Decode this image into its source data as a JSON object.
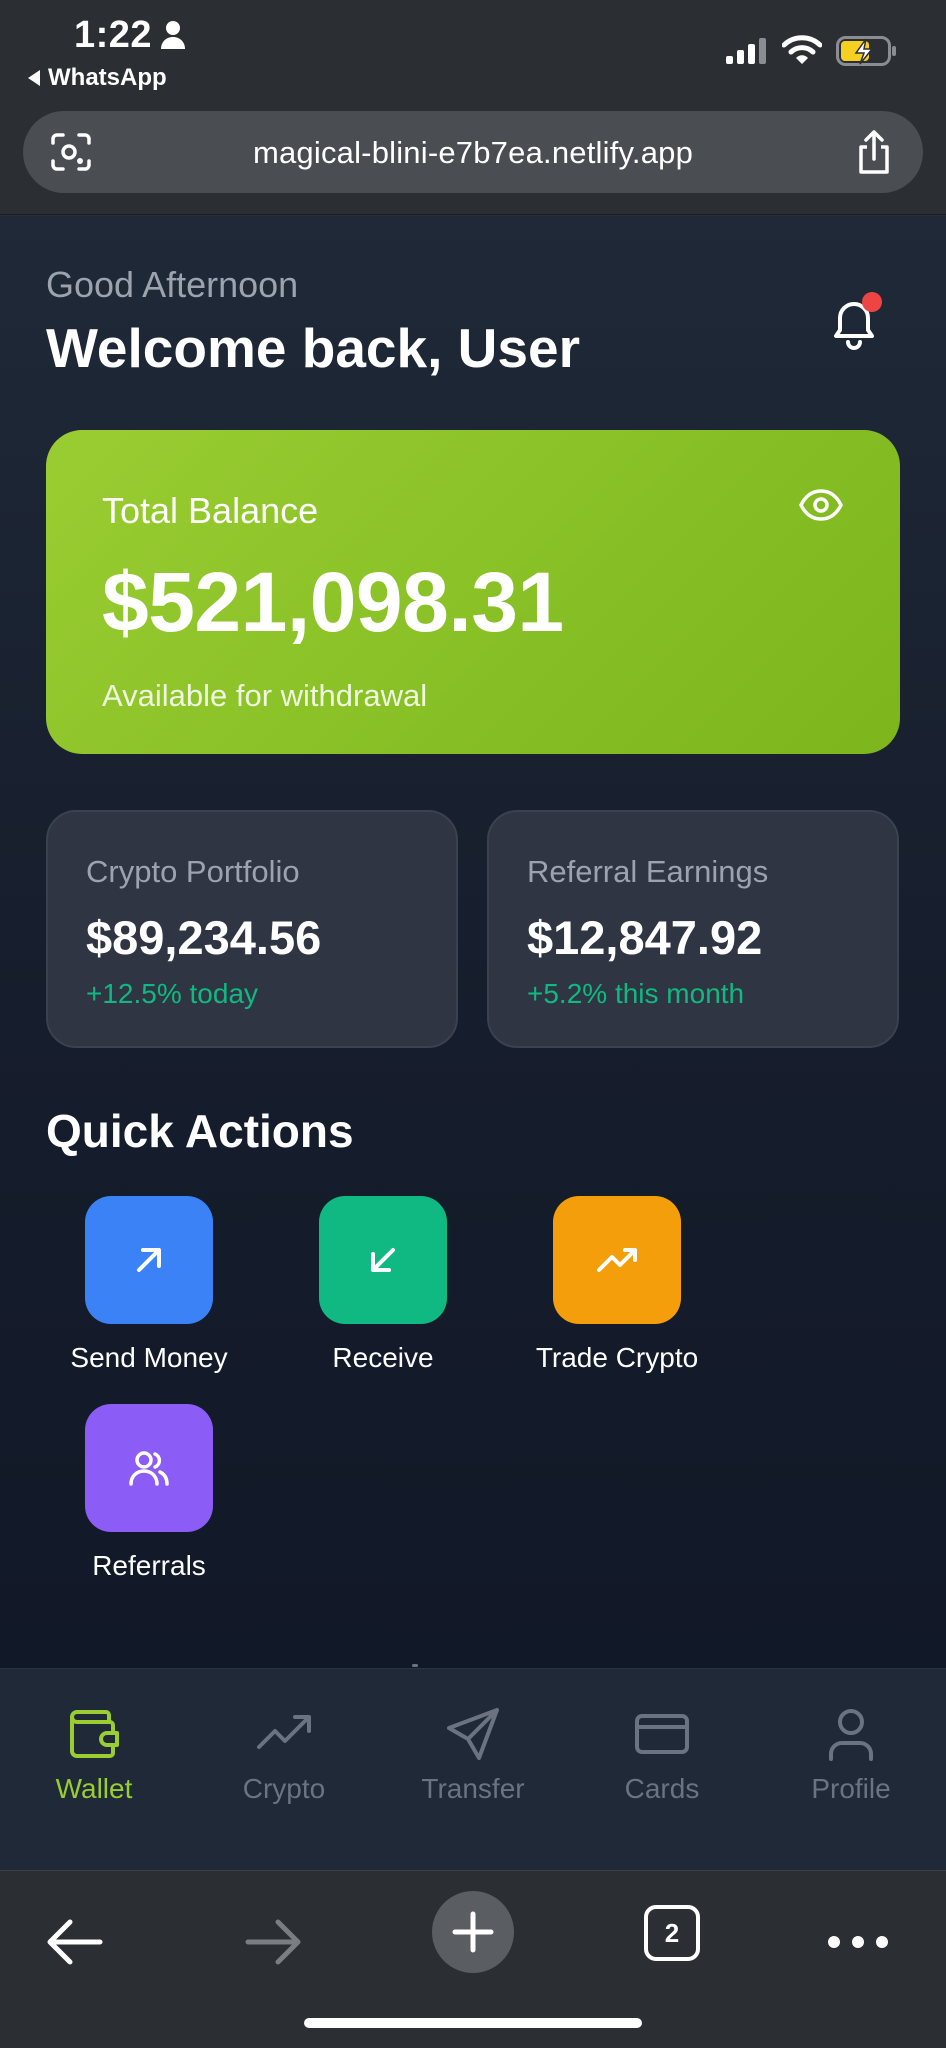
{
  "status_bar": {
    "time": "1:22",
    "back_app": "WhatsApp"
  },
  "browser": {
    "url": "magical-blini-e7b7ea.netlify.app",
    "tab_count": "2"
  },
  "header": {
    "greeting": "Good Afternoon",
    "welcome": "Welcome back, User",
    "has_notification": true
  },
  "balance": {
    "label": "Total Balance",
    "amount": "$521,098.31",
    "subtitle": "Available for withdrawal"
  },
  "stats": [
    {
      "label": "Crypto Portfolio",
      "value": "$89,234.56",
      "change": "+12.5% today"
    },
    {
      "label": "Referral Earnings",
      "value": "$12,847.92",
      "change": "+5.2% this month"
    }
  ],
  "quick_actions": {
    "title": "Quick Actions",
    "items": [
      {
        "label": "Send Money",
        "icon": "arrow-up-right-icon",
        "color": "#3b82f6"
      },
      {
        "label": "Receive",
        "icon": "arrow-down-left-icon",
        "color": "#10b981"
      },
      {
        "label": "Trade Crypto",
        "icon": "trending-up-icon",
        "color": "#f59e0b"
      },
      {
        "label": "Referrals",
        "icon": "users-icon",
        "color": "#8b5cf6"
      }
    ]
  },
  "bottom_nav": {
    "items": [
      {
        "label": "Wallet",
        "icon": "wallet-icon",
        "active": true
      },
      {
        "label": "Crypto",
        "icon": "trending-up-icon",
        "active": false
      },
      {
        "label": "Transfer",
        "icon": "send-icon",
        "active": false
      },
      {
        "label": "Cards",
        "icon": "credit-card-icon",
        "active": false
      },
      {
        "label": "Profile",
        "icon": "user-icon",
        "active": false
      }
    ]
  },
  "colors": {
    "accent": "#9acd32",
    "positive": "#10b981",
    "notification": "#ef4444"
  }
}
